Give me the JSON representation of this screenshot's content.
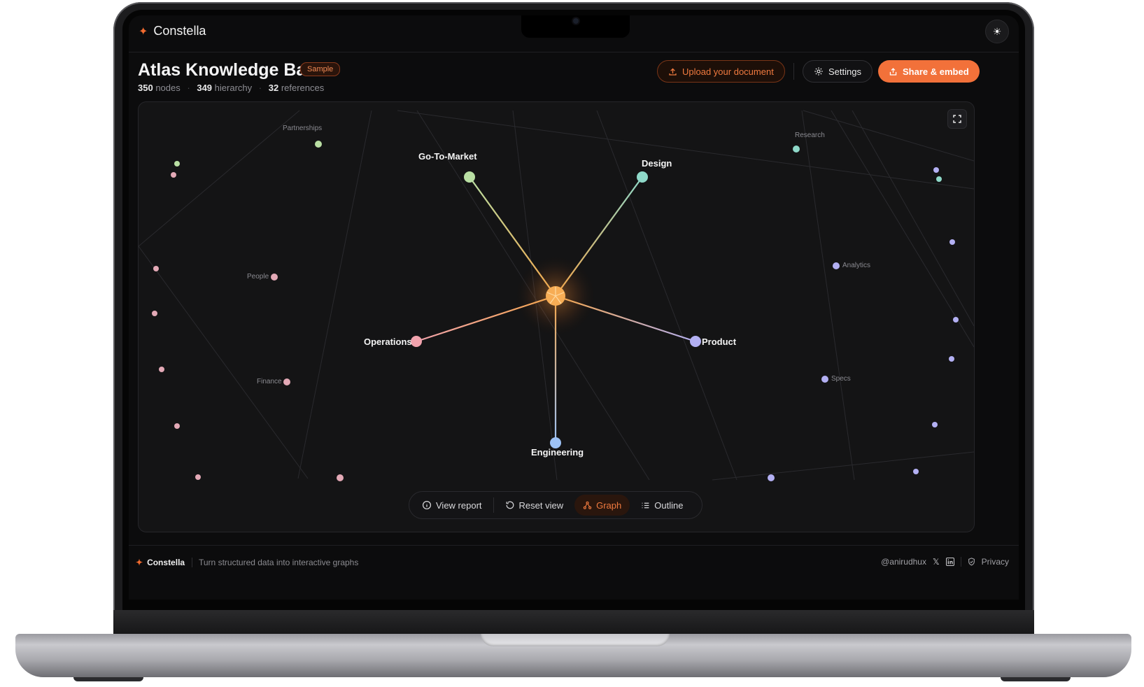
{
  "app": {
    "name": "Constella",
    "theme_toggle_icon": "sun-icon"
  },
  "header": {
    "title": "Atlas Knowledge Base",
    "badge": "Sample",
    "stats": [
      {
        "value": "350",
        "label": "nodes"
      },
      {
        "value": "349",
        "label": "hierarchy"
      },
      {
        "value": "32",
        "label": "references"
      }
    ],
    "upload_label": "Upload your document",
    "settings_label": "Settings",
    "share_label": "Share & embed"
  },
  "graph": {
    "center_node": "Atlas Knowledge Base",
    "primary_nodes": [
      "Go-To-Market",
      "Design",
      "Operations",
      "Product",
      "Engineering"
    ],
    "secondary_labels": [
      "Partnerships",
      "Research",
      "People",
      "Analytics",
      "Finance",
      "Specs"
    ],
    "colors": {
      "center": "#f5a64a",
      "go_to_market": "#b9dfa3",
      "design": "#8fd9c9",
      "operations": "#f1a3ad",
      "product": "#b3b0f3",
      "engineering": "#9cc1f5",
      "accent": "#f2713a"
    }
  },
  "toolbar": {
    "view_report": "View report",
    "reset_view": "Reset view",
    "graph": "Graph",
    "outline": "Outline",
    "active": "Graph"
  },
  "footer": {
    "brand": "Constella",
    "tagline": "Turn structured data into interactive graphs",
    "handle": "@anirudhux",
    "privacy": "Privacy"
  }
}
